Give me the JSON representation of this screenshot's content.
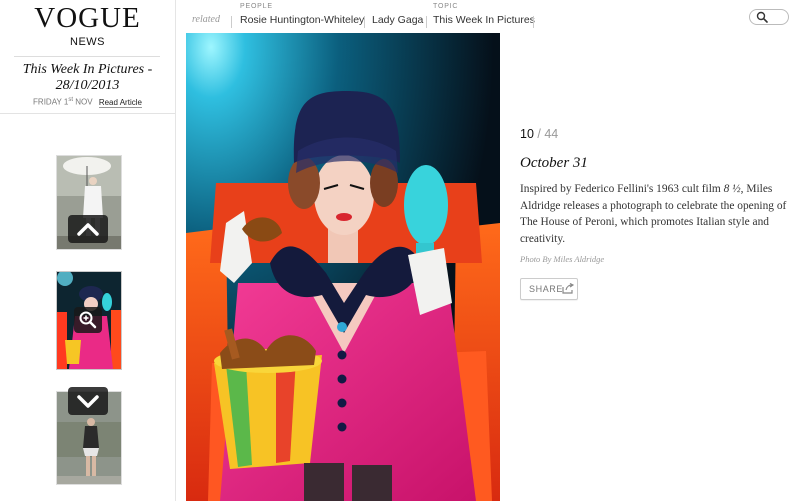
{
  "brand": {
    "logo": "VOGUE",
    "section": "NEWS"
  },
  "article": {
    "title": "This Week In Pictures - 28/10/2013",
    "date_day": "FRIDAY 1",
    "date_sup": "st",
    "date_month": "NOV",
    "read_label": "Read Article"
  },
  "topbar": {
    "related_label": "related",
    "people_label": "PEOPLE",
    "people": [
      "Rosie Huntington-Whiteley",
      "Lady Gaga"
    ],
    "topic_label": "TOPIC",
    "topic": "This Week In Pictures"
  },
  "gallery": {
    "current": "10",
    "separator": "/",
    "total": "44",
    "caption_date": "October 31",
    "desc_before": "Inspired by Federico Fellini's 1963 cult film ",
    "desc_film": "8 ½",
    "desc_after": ", Miles Aldridge releases a photograph to celebrate the opening of The House of Peroni, which promotes Italian style and creativity.",
    "credit": "Photo By Miles Aldridge",
    "share_label": "SHARE"
  },
  "colors": {
    "accent_text": "#222222",
    "muted": "#999999",
    "pink": "#e0207a",
    "cyan": "#2fd0d8"
  }
}
